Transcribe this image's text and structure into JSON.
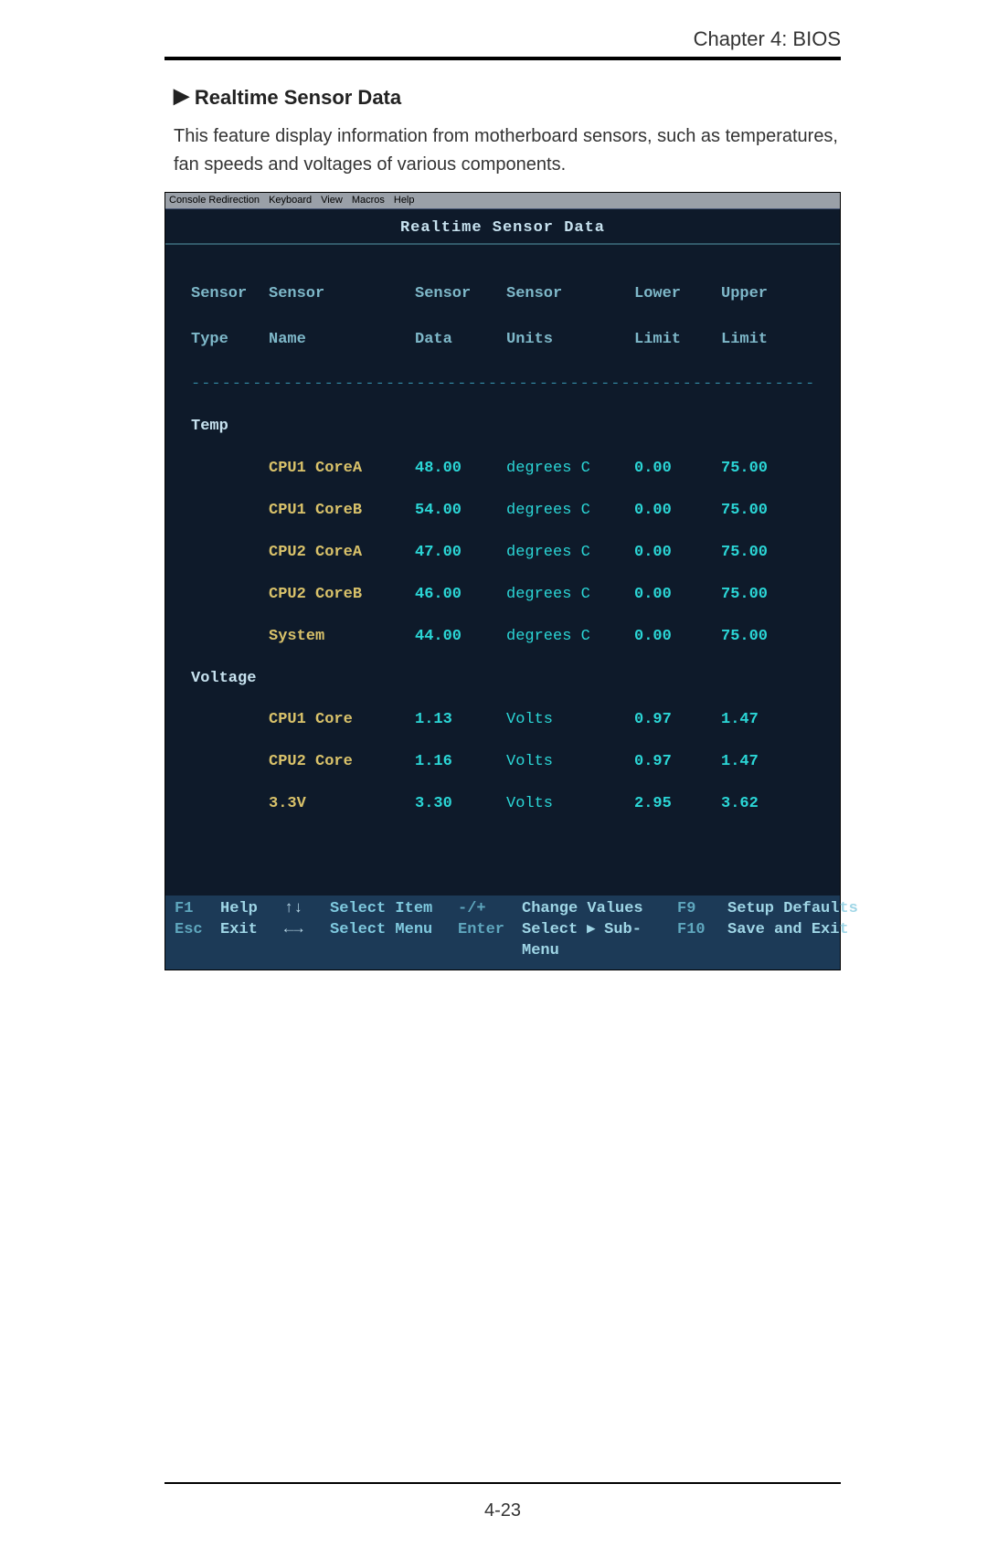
{
  "page": {
    "chapter": "Chapter 4: BIOS",
    "section_title": "Realtime Sensor Data",
    "body_text": "This feature display information from motherboard sensors, such as temperatures, fan speeds and voltages of various components.",
    "page_number": "4-23"
  },
  "kvm_menu": [
    "Console Redirection",
    "Keyboard",
    "View",
    "Macros",
    "Help"
  ],
  "bios": {
    "title": "Realtime Sensor Data",
    "headers": {
      "type1": "Sensor",
      "type2": "Type",
      "name1": "Sensor",
      "name2": "Name",
      "data1": "Sensor",
      "data2": "Data",
      "units1": "Sensor",
      "units2": "Units",
      "low1": "Lower",
      "low2": "Limit",
      "up1": "Upper",
      "up2": "Limit"
    },
    "groups": [
      {
        "label": "Temp",
        "rows": [
          {
            "name": "CPU1 CoreA",
            "data": "48.00",
            "units": "degrees C",
            "low": "0.00",
            "up": "75.00"
          },
          {
            "name": "CPU1 CoreB",
            "data": "54.00",
            "units": "degrees C",
            "low": "0.00",
            "up": "75.00"
          },
          {
            "name": "CPU2 CoreA",
            "data": "47.00",
            "units": "degrees C",
            "low": "0.00",
            "up": "75.00"
          },
          {
            "name": "CPU2 CoreB",
            "data": "46.00",
            "units": "degrees C",
            "low": "0.00",
            "up": "75.00"
          },
          {
            "name": "System",
            "data": "44.00",
            "units": "degrees C",
            "low": "0.00",
            "up": "75.00"
          }
        ]
      },
      {
        "label": "Voltage",
        "rows": [
          {
            "name": "CPU1 Core",
            "data": "1.13",
            "units": "Volts",
            "low": "0.97",
            "up": "1.47"
          },
          {
            "name": "CPU2 Core",
            "data": "1.16",
            "units": "Volts",
            "low": "0.97",
            "up": "1.47"
          },
          {
            "name": "3.3V",
            "data": "3.30",
            "units": "Volts",
            "low": "2.95",
            "up": "3.62"
          }
        ]
      }
    ],
    "help": {
      "f1": "F1",
      "f1_act": "Help",
      "arrows": "↑↓",
      "arrows_act": "Select Item",
      "pm": "-/+",
      "pm_act": "Change Values",
      "f9": "F9",
      "f9_act": "Setup Defaults",
      "esc": "Esc",
      "esc_act": "Exit",
      "lr": "←→",
      "lr_act": "Select Menu",
      "enter": "Enter",
      "enter_act": "Select ▸ Sub-Menu",
      "f10": "F10",
      "f10_act": "Save and Exit"
    }
  }
}
